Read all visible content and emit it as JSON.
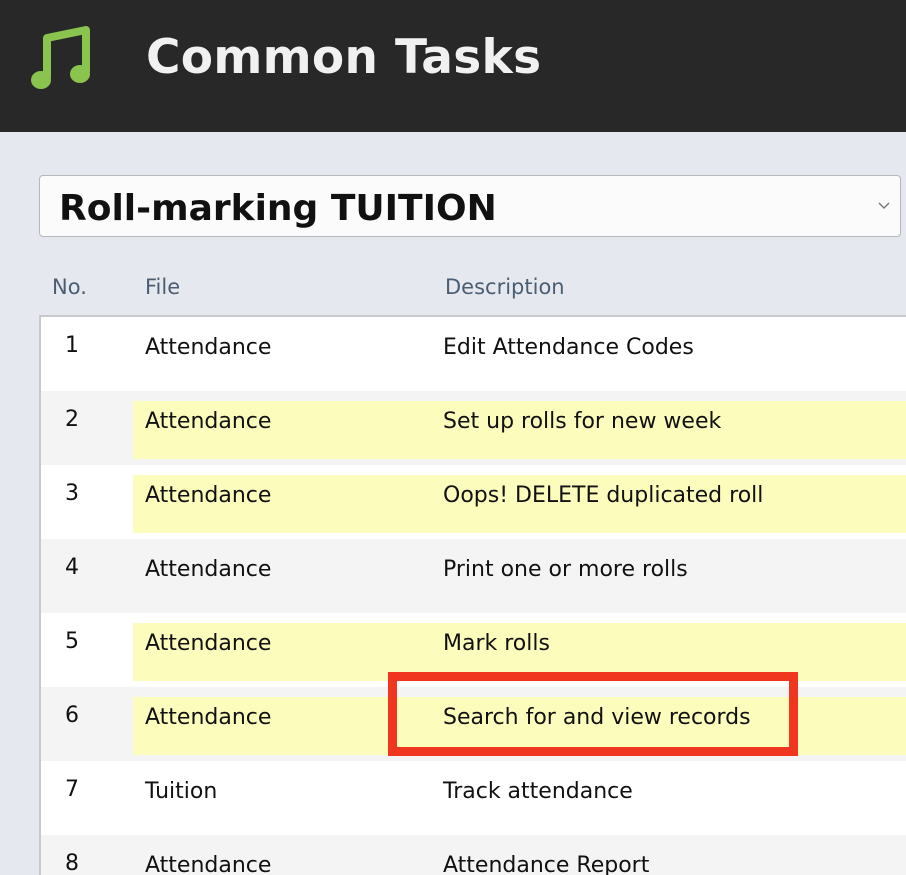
{
  "header": {
    "title": "Common Tasks",
    "icon": "music-note-icon"
  },
  "selector": {
    "value": "Roll-marking TUITION",
    "icon": "chevron-down-icon"
  },
  "columns": {
    "no": "No.",
    "file": "File",
    "description": "Description"
  },
  "rows": [
    {
      "no": "1",
      "file": "Attendance",
      "description": "Edit Attendance Codes",
      "highlighted": false
    },
    {
      "no": "2",
      "file": "Attendance",
      "description": "Set up rolls for new week",
      "highlighted": true
    },
    {
      "no": "3",
      "file": "Attendance",
      "description": "Oops! DELETE duplicated roll",
      "highlighted": true
    },
    {
      "no": "4",
      "file": "Attendance",
      "description": "Print one or more rolls",
      "highlighted": false
    },
    {
      "no": "5",
      "file": "Attendance",
      "description": "Mark rolls",
      "highlighted": true
    },
    {
      "no": "6",
      "file": "Attendance",
      "description": "Search for and view records",
      "highlighted": true
    },
    {
      "no": "7",
      "file": "Tuition",
      "description": "Track attendance",
      "highlighted": false
    },
    {
      "no": "8",
      "file": "Attendance",
      "description": "Attendance Report",
      "highlighted": false
    }
  ],
  "colors": {
    "header_bg": "#282828",
    "icon_green": "#8ac44e",
    "row_highlight": "#fcfcbc",
    "callout_red": "#f0361f"
  }
}
